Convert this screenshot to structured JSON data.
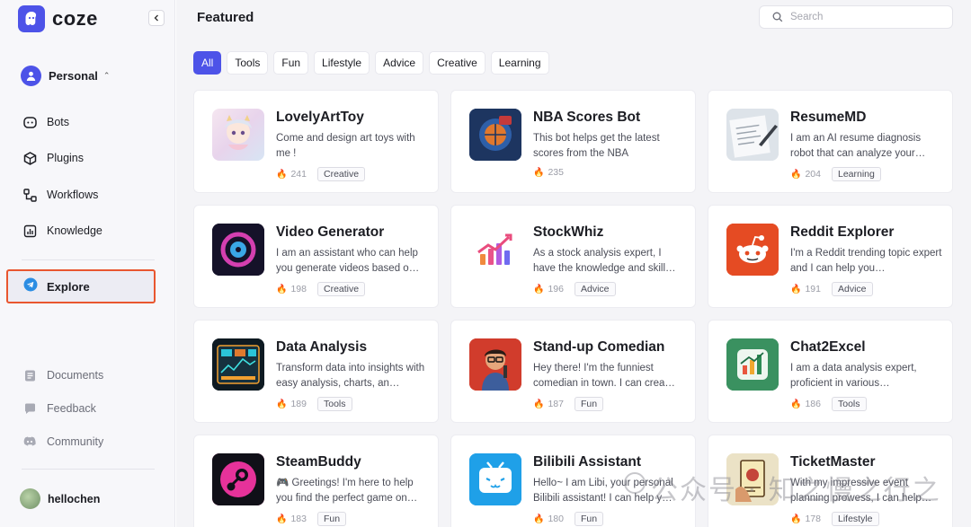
{
  "app": {
    "name": "coze"
  },
  "sidebar": {
    "workspace": "Personal",
    "items": [
      {
        "label": "Bots",
        "icon": "bot-icon"
      },
      {
        "label": "Plugins",
        "icon": "plugin-icon"
      },
      {
        "label": "Workflows",
        "icon": "workflow-icon"
      },
      {
        "label": "Knowledge",
        "icon": "knowledge-icon"
      }
    ],
    "explore": "Explore",
    "footer_items": [
      {
        "label": "Documents",
        "icon": "document-icon"
      },
      {
        "label": "Feedback",
        "icon": "feedback-icon"
      },
      {
        "label": "Community",
        "icon": "community-icon"
      }
    ],
    "user": "hellochen"
  },
  "main": {
    "title": "Featured",
    "search_placeholder": "Search",
    "tabs": [
      "All",
      "Tools",
      "Fun",
      "Lifestyle",
      "Advice",
      "Creative",
      "Learning"
    ],
    "active_tab": "All",
    "cards": [
      {
        "title": "LovelyArtToy",
        "desc": "Come and design art toys with me !",
        "count": "241",
        "tag": "Creative"
      },
      {
        "title": "NBA Scores Bot",
        "desc": "This bot helps get the latest scores from the NBA",
        "count": "235",
        "tag": ""
      },
      {
        "title": "ResumeMD",
        "desc": "I am an AI resume diagnosis robot that can analyze your…",
        "count": "204",
        "tag": "Learning"
      },
      {
        "title": "Video Generator",
        "desc": "I am an assistant who can help you generate videos based o…",
        "count": "198",
        "tag": "Creative"
      },
      {
        "title": "StockWhiz",
        "desc": "As a stock analysis expert, I have the knowledge and skill…",
        "count": "196",
        "tag": "Advice"
      },
      {
        "title": "Reddit Explorer",
        "desc": "I'm a Reddit trending topic expert and I can help you…",
        "count": "191",
        "tag": "Advice"
      },
      {
        "title": "Data Analysis",
        "desc": "Transform data into insights with easy analysis, charts, an…",
        "count": "189",
        "tag": "Tools"
      },
      {
        "title": "Stand-up Comedian",
        "desc": "Hey there! I'm the funniest comedian in town. I can crea…",
        "count": "187",
        "tag": "Fun"
      },
      {
        "title": "Chat2Excel",
        "desc": "I am a data analysis expert, proficient in various…",
        "count": "186",
        "tag": "Tools"
      },
      {
        "title": "SteamBuddy",
        "desc": "🎮 Greetings! I'm here to help you find the perfect game on…",
        "count": "183",
        "tag": "Fun"
      },
      {
        "title": "Bilibili Assistant",
        "desc": "Hello~ I am Libi, your personal Bilibili assistant! I can help y…",
        "count": "180",
        "tag": "Fun"
      },
      {
        "title": "TicketMaster",
        "desc": "With my impressive event planning prowess, I can help…",
        "count": "178",
        "tag": "Lifestyle"
      }
    ]
  },
  "watermark": "公众号 · 知之慢之行之",
  "colors": {
    "accent": "#4d53e8",
    "highlight_border": "#e9562f",
    "flame": "#f2a33a"
  }
}
